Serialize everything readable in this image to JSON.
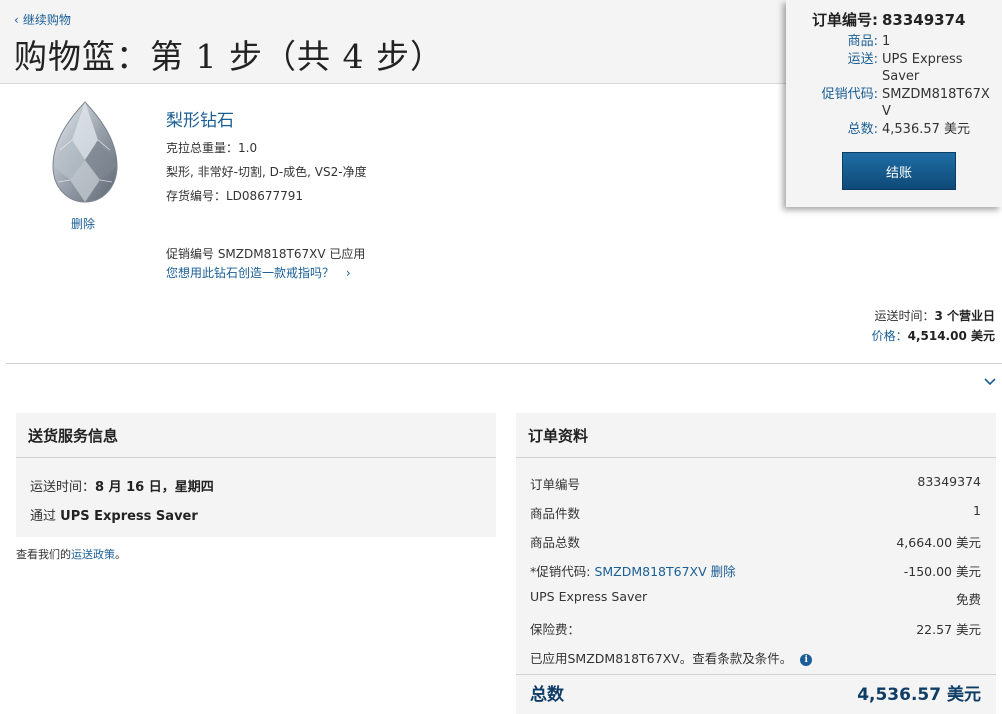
{
  "header": {
    "continue_label": "继续购物",
    "title": "购物篮：第 1 步（共 4 步）"
  },
  "summary": {
    "order_no_label": "订单编号:",
    "order_no": "83349374",
    "items_label": "商品:",
    "items": "1",
    "shipping_label": "运送:",
    "shipping": "UPS Express Saver",
    "promo_label": "促销代码:",
    "promo": "SMZDM818T67XV",
    "total_label": "总数:",
    "total": "4,536.57 美元",
    "checkout_label": "结账"
  },
  "item": {
    "title": "梨形钻石",
    "carat": "克拉总重量：1.0",
    "desc": "梨形, 非常好-切割, D-成色, VS2-净度",
    "sku": "存货编号：LD08677791",
    "delete_label": "删除",
    "promo_applied": "促销编号 SMZDM818T67XV 已应用",
    "ring_link": "您想用此钻石创造一款戒指吗？",
    "ship_time_label": "运送时间：",
    "ship_time_value": "3 个营业日",
    "price_label": "价格：",
    "price_value": "4,514.00 美元"
  },
  "delivery": {
    "heading": "送货服务信息",
    "time_label": "运送时间：",
    "time_value": "8 月 16 日，星期四",
    "via_label": "通过",
    "via_value": "UPS Express Saver",
    "policy_prefix": "查看我们的",
    "policy_link": "运送政策",
    "policy_suffix": "。"
  },
  "order": {
    "heading": "订单资料",
    "rows": [
      {
        "label": "订单编号",
        "value": "83349374"
      },
      {
        "label": "商品件数",
        "value": "1"
      },
      {
        "label": "商品总数",
        "value": "4,664.00 美元"
      },
      {
        "label": "*促销代码: ",
        "code": "SMZDM818T67XV",
        "remove": "删除",
        "value": "-150.00 美元"
      },
      {
        "label": "UPS Express Saver",
        "value": "免费"
      },
      {
        "label": "保险费：",
        "value": "22.57 美元"
      }
    ],
    "applied_note": "已应用SMZDM818T67XV。查看条款及条件。",
    "total_label": "总数",
    "total_value": "4,536.57 美元"
  },
  "colors": {
    "link": "#1a5e95",
    "button": "#145a8c",
    "panel": "#f4f4f4"
  },
  "icons": [
    "chevron-left-icon",
    "chevron-right-icon",
    "chevron-down-icon",
    "info-icon"
  ]
}
